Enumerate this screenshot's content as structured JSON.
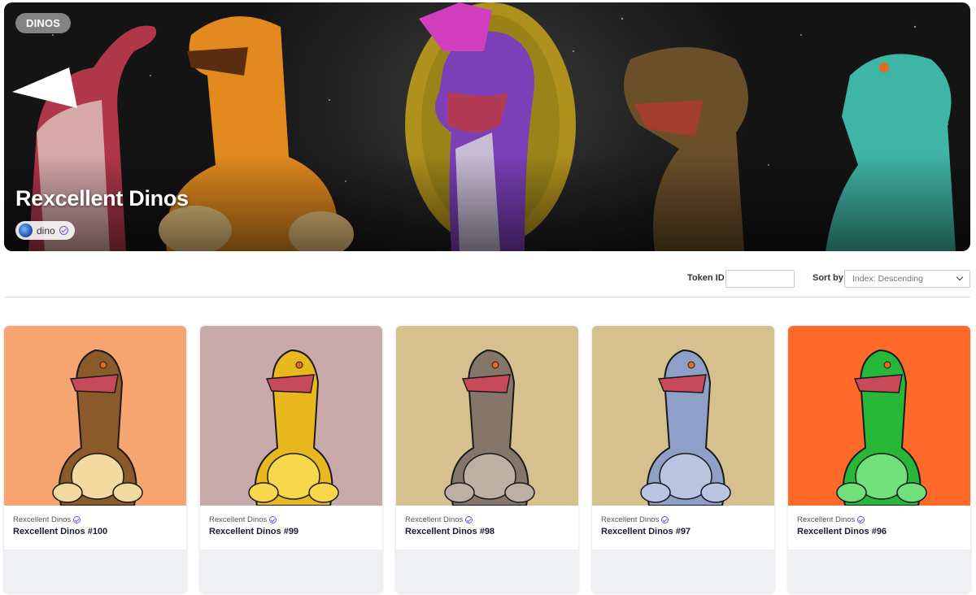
{
  "banner": {
    "tag": "DINOS",
    "title": "Rexcellent Dinos",
    "owner": {
      "name": "dino",
      "avatar_icon": "globe-avatar-icon",
      "verified_icon": "verified-check-icon"
    }
  },
  "toolbar": {
    "token_id_label": "Token ID",
    "token_id_value": "",
    "sort_label": "Sort by",
    "sort_value": "Index: Descending"
  },
  "cards": [
    {
      "collection": "Rexcellent Dinos",
      "name": "Rexcellent Dinos #100",
      "bg": "#f7a570",
      "dino": "#8b5a2b",
      "belly": "#f1d9a0"
    },
    {
      "collection": "Rexcellent Dinos",
      "name": "Rexcellent Dinos #99",
      "bg": "#c9a9a9",
      "dino": "#e8b81e",
      "belly": "#f7d84a"
    },
    {
      "collection": "Rexcellent Dinos",
      "name": "Rexcellent Dinos #98",
      "bg": "#d6c08e",
      "dino": "#857669",
      "belly": "#bdb0a2"
    },
    {
      "collection": "Rexcellent Dinos",
      "name": "Rexcellent Dinos #97",
      "bg": "#d6c08e",
      "dino": "#8fa0c8",
      "belly": "#b9c5e0"
    },
    {
      "collection": "Rexcellent Dinos",
      "name": "Rexcellent Dinos #96",
      "bg": "#ff6a2a",
      "dino": "#27b83a",
      "belly": "#6fe07a"
    }
  ]
}
